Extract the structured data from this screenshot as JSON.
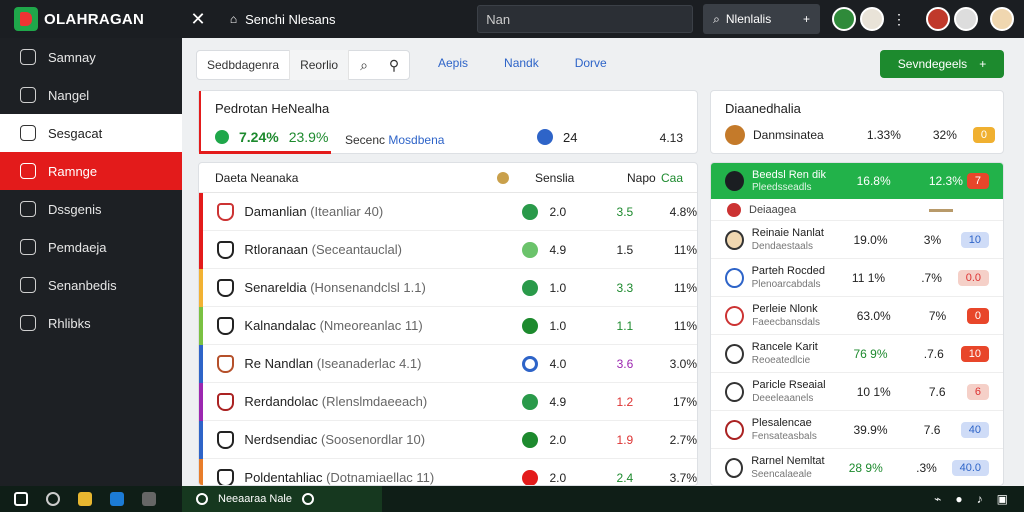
{
  "topbar": {
    "logo": "OLAHRAGAN",
    "close": "✕",
    "title": "Senchi Nlesans",
    "input_value": "Nan",
    "search_label": "Nlenlalis",
    "plus": "+",
    "kebab": "⋮"
  },
  "sidebar": {
    "items": [
      {
        "label": "Samnay"
      },
      {
        "label": "Nangel"
      },
      {
        "label": "Sesgacat"
      },
      {
        "label": "Ramnge"
      },
      {
        "label": "Dssgenis"
      },
      {
        "label": "Pemdaeja"
      },
      {
        "label": "Senanbedis"
      },
      {
        "label": "Rhlibks"
      }
    ]
  },
  "filter": {
    "seg1": "Sedbdagenra",
    "seg2": "Reorlio"
  },
  "tabs": [
    "Aepis",
    "Nandk",
    "Dorve"
  ],
  "action_button": {
    "label": "Sevndegeels",
    "plus": "+"
  },
  "summary": {
    "title": "Pedrotan HeNealha",
    "stat1": "7.24%",
    "stat2": "23.9%",
    "meta_label": "Secenc",
    "meta_link": "Mosdbena",
    "count": "24",
    "right_value": "4.13"
  },
  "right_head": {
    "title": "Diaanedhalia",
    "row": {
      "name": "Danmsinatea",
      "v1": "1.33%",
      "v2": "32%",
      "pill": "0"
    }
  },
  "table": {
    "headers": {
      "name": "Daeta Neanaka",
      "c1": "Senslia",
      "c2": "Napo",
      "c3": "Caa"
    },
    "rows": [
      {
        "name": "Damanlian",
        "sub": "(Iteanliar 40)",
        "c1": "2.0",
        "c2": "3.5",
        "c3": "4.8%"
      },
      {
        "name": "Rtloranaan",
        "sub": "(Seceantauclal)",
        "c1": "4.9",
        "c2": "1.5",
        "c3": "11%"
      },
      {
        "name": "Senareldia",
        "sub": "(Honsenandclsl 1.1)",
        "c1": "1.0",
        "c2": "3.3",
        "c3": "11%"
      },
      {
        "name": "Kalnandalac",
        "sub": "(Nmeoreanlac 11)",
        "c1": "1.0",
        "c2": "1.1",
        "c3": "11%"
      },
      {
        "name": "Re Nandlan",
        "sub": "(Iseanaderlac 4.1)",
        "c1": "4.0",
        "c2": "3.6",
        "c3": "3.0%"
      },
      {
        "name": "Rerdandolac",
        "sub": "(Rlenslmdaeeach)",
        "c1": "4.9",
        "c2": "1.2",
        "c3": "17%"
      },
      {
        "name": "Nerdsendiac",
        "sub": "(Soosenordlar 10)",
        "c1": "2.0",
        "c2": "1.9",
        "c3": "2.7%"
      },
      {
        "name": "Poldentahliac",
        "sub": "(Dotnamiaellac 11)",
        "c1": "2.0",
        "c2": "2.4",
        "c3": "3.7%"
      }
    ]
  },
  "right_list": {
    "top": {
      "name": "Beedsl Ren dik",
      "sub": "Pleedsseadls",
      "v1": "16.8%",
      "v2": "12.3%",
      "pill": "7"
    },
    "sub_label": "Deiaagea",
    "rows": [
      {
        "name": "Reinaie Nanlat",
        "sub": "Dendaestaals",
        "v1": "19.0%",
        "v2": "3%",
        "pill": "10"
      },
      {
        "name": "Parteh Rocded",
        "sub": "Plenoarcabdals",
        "v1": "11 1%",
        "v2": ".7%",
        "pill": "0.0"
      },
      {
        "name": "Perleie Nlonk",
        "sub": "Faeecbansdals",
        "v1": "63.0%",
        "v2": "7%",
        "pill": "0"
      },
      {
        "name": "Rancele Karit",
        "sub": "Reoeatedlcie",
        "v1": "76 9%",
        "v2": ".7.6",
        "pill": "10"
      },
      {
        "name": "Paricle Rseaial",
        "sub": "Deeeleaanels",
        "v1": "10 1%",
        "v2": "7.6",
        "pill": "6"
      },
      {
        "name": "Plesalencae",
        "sub": "Fensateasbals",
        "v1": "39.9%",
        "v2": "7.6",
        "pill": "40"
      },
      {
        "name": "Rarnel Nemltat",
        "sub": "Seencalaeale",
        "v1": "28 9%",
        "v2": ".3%",
        "pill": "40.0"
      }
    ]
  },
  "taskbar": {
    "app_label": "Neeaaraa Nale"
  },
  "colors": {
    "accent_red": "#e31b1b",
    "accent_green": "#1d8a2e",
    "bright_green": "#22b24a",
    "sidebar_bg": "#1d2024",
    "link_blue": "#2e64c8"
  }
}
